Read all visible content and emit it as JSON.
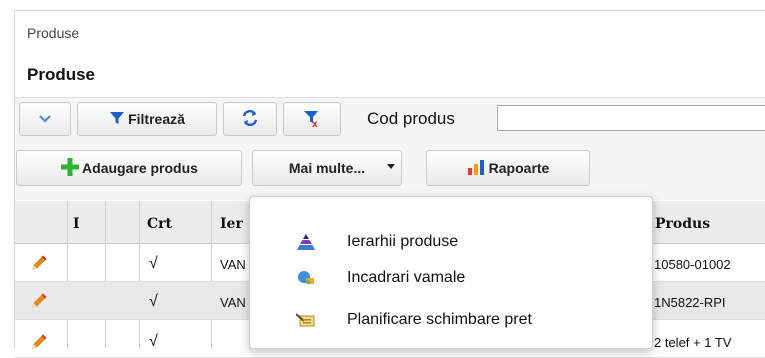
{
  "breadcrumb": "Produse",
  "page_title": "Produse",
  "toolbar": {
    "filter_label": "Filtrează",
    "cod_produs_label": "Cod produs",
    "cod_produs_value": ""
  },
  "actions": {
    "add_label": "Adaugare produs",
    "more_label": "Mai multe...",
    "reports_label": "Rapoarte"
  },
  "grid": {
    "columns": [
      "I",
      "Crt",
      "Ier",
      "Produs"
    ],
    "rows": [
      {
        "crt": "√",
        "ier": "VAN",
        "produs": "10580-01002"
      },
      {
        "crt": "√",
        "ier": "VAN",
        "produs": "1N5822-RPI"
      },
      {
        "crt": "√",
        "ier": "",
        "produs": "2 telef + 1 TV"
      }
    ]
  },
  "dropdown": {
    "items": [
      {
        "label": "Ierarhii produse",
        "icon": "pyramid-icon"
      },
      {
        "label": "Incadrari vamale",
        "icon": "customs-icon"
      },
      {
        "label": "Planificare schimbare pret",
        "icon": "price-plan-icon",
        "highlighted": true
      }
    ]
  },
  "colors": {
    "highlight": "#ffff66",
    "add_green": "#2fb32f",
    "filter_blue": "#1a5fd0",
    "edit_orange": "#e08a1e"
  }
}
